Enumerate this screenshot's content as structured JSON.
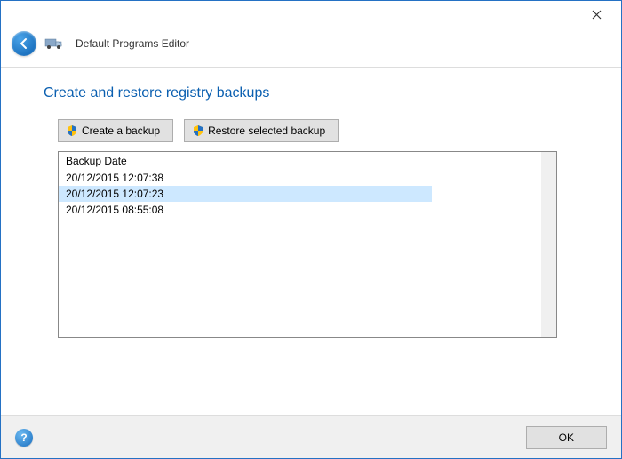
{
  "window": {
    "app_title": "Default Programs Editor"
  },
  "page": {
    "heading": "Create and restore registry backups"
  },
  "buttons": {
    "create_backup": "Create a backup",
    "restore_backup": "Restore selected backup",
    "ok": "OK"
  },
  "list": {
    "header": "Backup Date",
    "items": [
      {
        "date": "20/12/2015 12:07:38",
        "selected": false
      },
      {
        "date": "20/12/2015 12:07:23",
        "selected": true
      },
      {
        "date": "20/12/2015 08:55:08",
        "selected": false
      }
    ]
  }
}
